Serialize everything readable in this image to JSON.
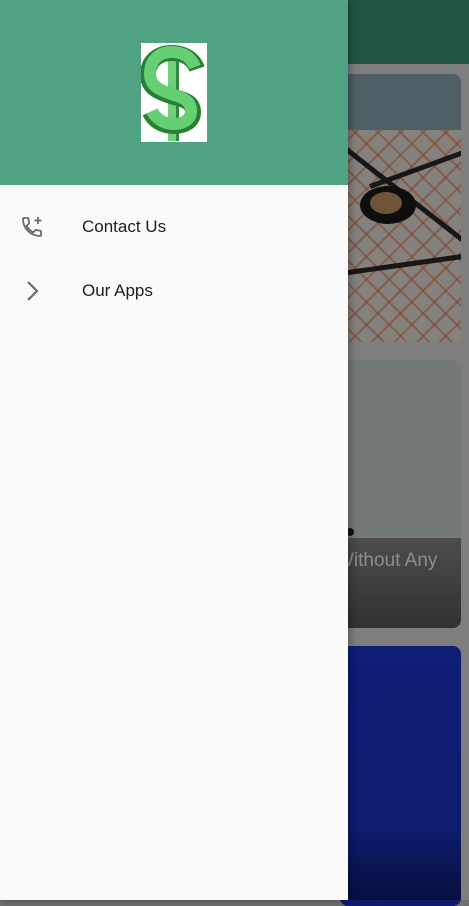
{
  "background": {
    "card2_text": "Without Any"
  },
  "drawer": {
    "logo_icon": "dollar-sign-icon",
    "items": [
      {
        "label": "Contact Us",
        "icon": "phone-add-icon"
      },
      {
        "label": "Our Apps",
        "icon": "chevron-right-icon"
      }
    ]
  },
  "colors": {
    "header_green": "#4fa282",
    "drawer_background": "#fafafa",
    "logo_green": "#3dbb4f"
  }
}
